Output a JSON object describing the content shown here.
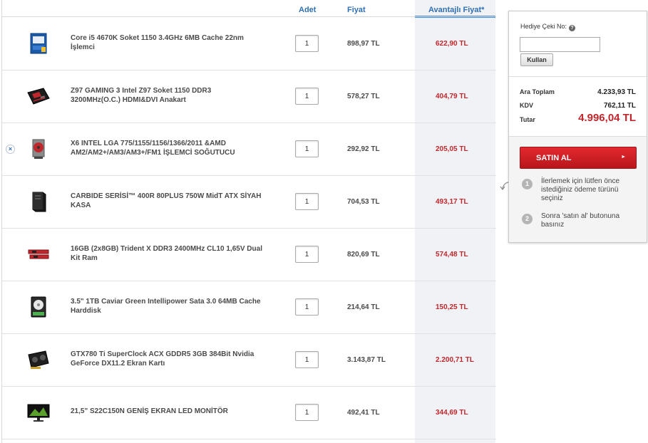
{
  "cart": {
    "headers": {
      "adet": "Adet",
      "fiyat": "Fiyat",
      "avantajli": "Avantajlı Fiyat*"
    },
    "remove_glyph": "×",
    "items": [
      {
        "name": "Core i5 4670K Soket 1150 3.4GHz 6MB Cache 22nm İşlemci",
        "qty": "1",
        "price": "898,97 TL",
        "advantage_price": "622,90 TL",
        "icon": "cpu-box-icon"
      },
      {
        "name": "Z97 GAMING 3 Intel Z97 Soket 1150 DDR3 3200MHz(O.C.) HDMI&DVI Anakart",
        "qty": "1",
        "price": "578,27 TL",
        "advantage_price": "404,79 TL",
        "icon": "motherboard-icon"
      },
      {
        "name": "X6 INTEL LGA 775/1155/1156/1366/2011 &AMD AM2/AM2+/AM3/AM3+/FM1 İŞLEMCİ SOĞUTUCU",
        "qty": "1",
        "price": "292,92 TL",
        "advantage_price": "205,05 TL",
        "icon": "cpu-cooler-icon"
      },
      {
        "name": "CARBIDE SERİSİ™ 400R 80PLUS 750W MidT ATX SİYAH KASA",
        "qty": "1",
        "price": "704,53 TL",
        "advantage_price": "493,17 TL",
        "icon": "pc-case-icon"
      },
      {
        "name": "16GB (2x8GB) Trident X DDR3 2400MHz CL10 1,65V Dual Kit Ram",
        "qty": "1",
        "price": "820,69 TL",
        "advantage_price": "574,48 TL",
        "icon": "ram-icon"
      },
      {
        "name": "3.5\" 1TB Caviar Green Intellipower Sata 3.0 64MB Cache Harddisk",
        "qty": "1",
        "price": "214,64 TL",
        "advantage_price": "150,25 TL",
        "icon": "hard-disk-icon"
      },
      {
        "name": "GTX780 Ti SuperClock ACX GDDR5 3GB 384Bit Nvidia GeForce DX11.2 Ekran Kartı",
        "qty": "1",
        "price": "3.143,87 TL",
        "advantage_price": "2.200,71 TL",
        "icon": "graphics-card-icon"
      },
      {
        "name": "21,5\" S22C150N GENİŞ EKRAN LED MONİTÖR",
        "qty": "1",
        "price": "492,41 TL",
        "advantage_price": "344,69 TL",
        "icon": "monitor-icon"
      }
    ]
  },
  "summary": {
    "gift_label": "Hediye Çeki No:",
    "help_glyph": "?",
    "gift_value": "",
    "apply_label": "Kullan",
    "subtotal_label": "Ara Toplam",
    "subtotal_value": "4.233,93 TL",
    "tax_label": "KDV",
    "tax_value": "762,11 TL",
    "total_label": "Tutar",
    "total_value": "4.996,04 TL",
    "buy_label": "SATIN AL",
    "buy_arrow": "►",
    "steps": [
      {
        "num": "1",
        "text": "İlerlemek için lütfen önce istediğiniz ödeme türünü seçiniz"
      },
      {
        "num": "2",
        "text": "Sonra 'satın al' butonuna basınız"
      }
    ]
  },
  "colors": {
    "accent_blue": "#2f6fb5",
    "price_red": "#c0272d",
    "buy_red": "#d41f26"
  }
}
